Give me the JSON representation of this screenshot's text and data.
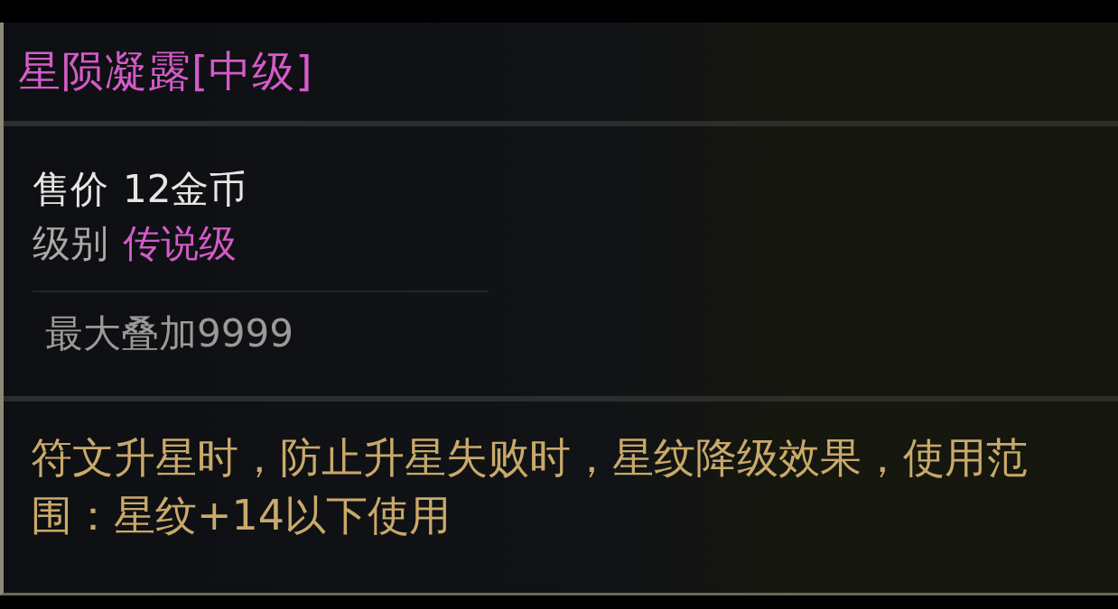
{
  "item": {
    "title": "星陨凝露[中级]",
    "price": {
      "label": "售价",
      "value": "12金币"
    },
    "grade": {
      "label": "级别",
      "value": "传说级"
    },
    "stack": "最大叠加9999",
    "description": "符文升星时，防止升星失败时，星纹降级效果，使用范围：星纹+14以下使用"
  }
}
